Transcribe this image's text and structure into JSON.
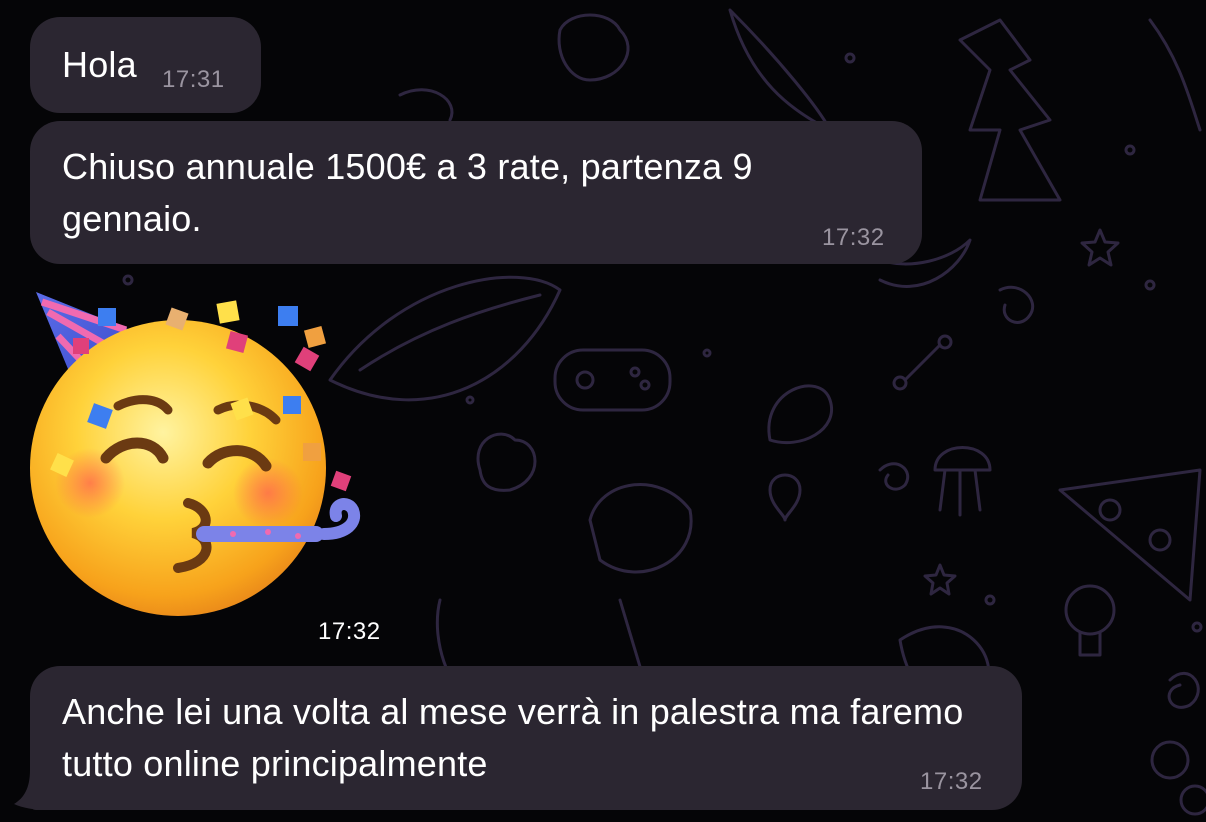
{
  "chat": {
    "messages": [
      {
        "text": "Hola",
        "time": "17:31"
      },
      {
        "text": "Chiuso annuale 1500€ a 3 rate, partenza 9 gennaio.",
        "time": "17:32"
      },
      {
        "sticker": "partying-face-sticker",
        "time": "17:32"
      },
      {
        "text": "Anche lei una volta al mese verrà in palestra ma faremo tutto online principalmente",
        "time": "17:32"
      }
    ]
  },
  "colors": {
    "background": "#050507",
    "bubble": "#2b2631",
    "doodle": "#2e2640",
    "timestamp": "#9a94a0",
    "text": "#ffffff"
  },
  "icons": [
    "doodle-pattern",
    "partying-face-sticker"
  ]
}
